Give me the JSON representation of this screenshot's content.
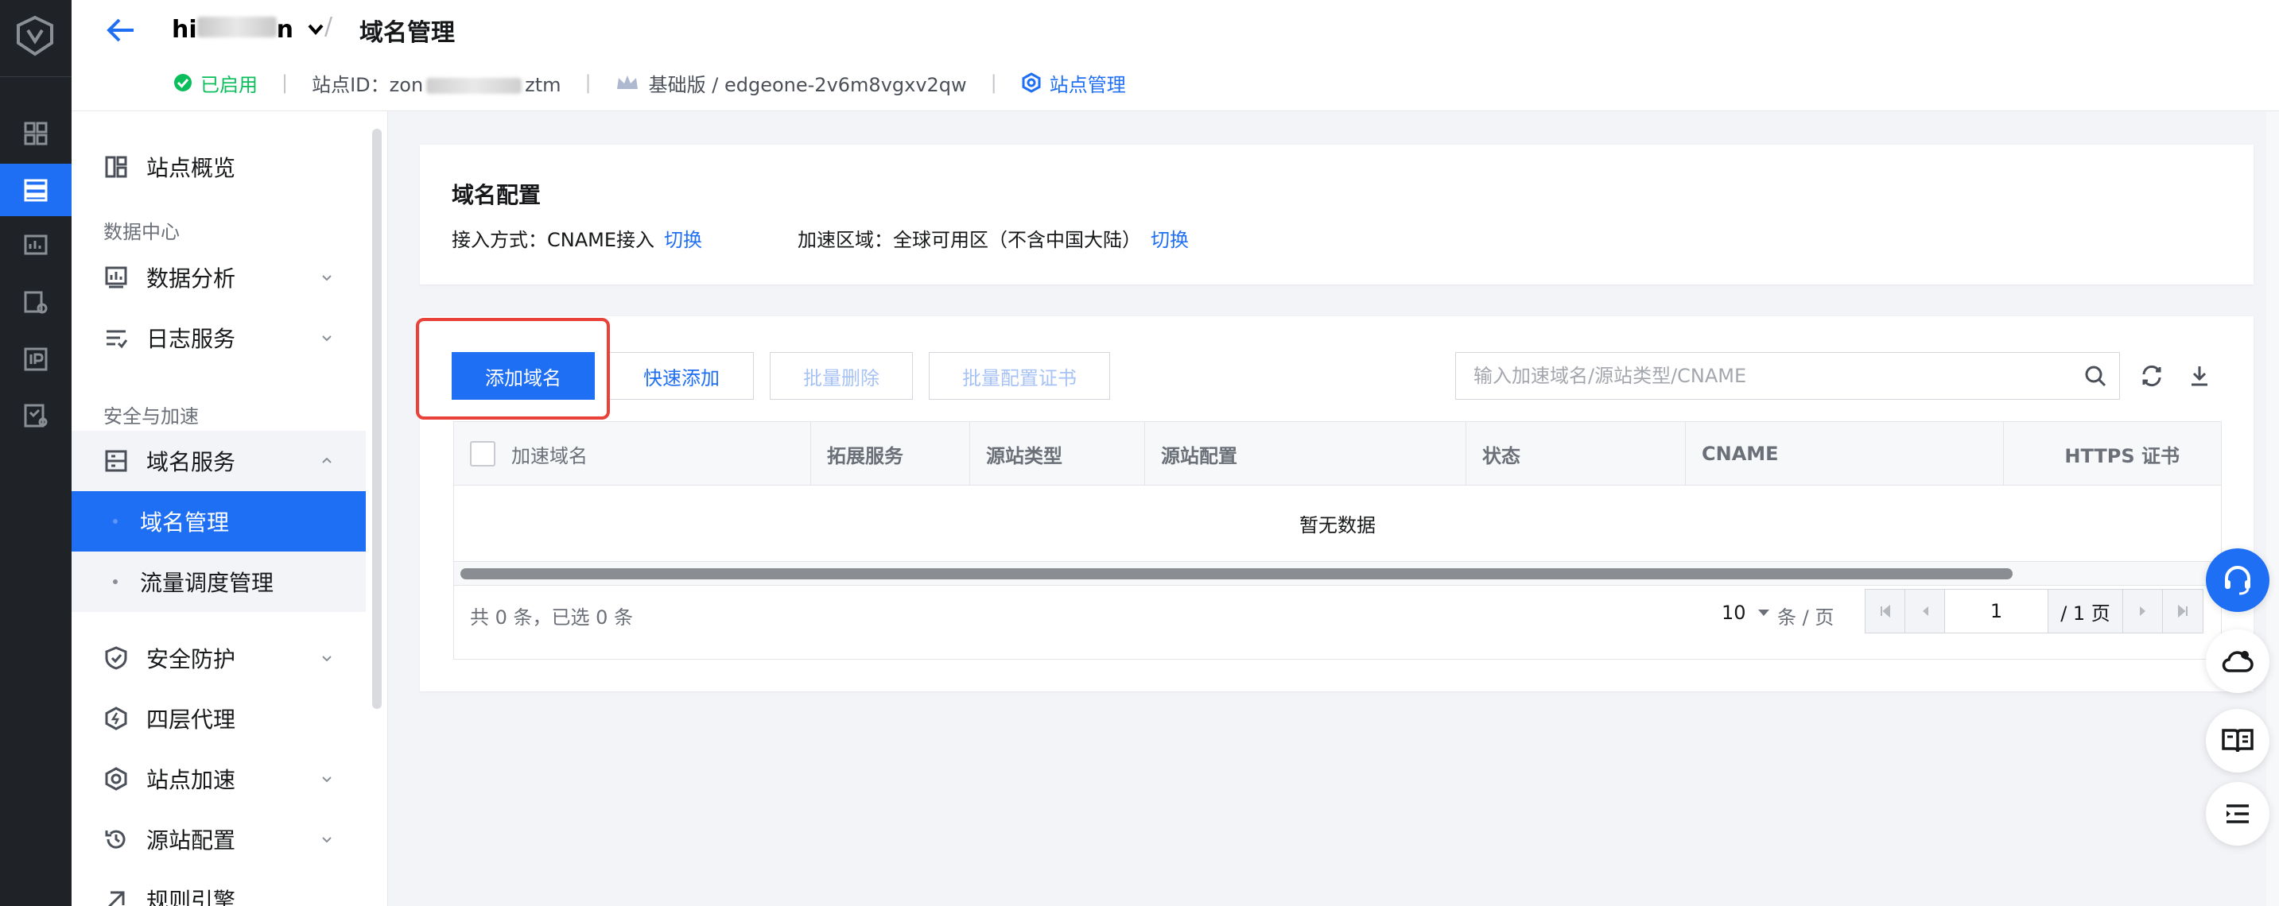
{
  "header": {
    "site_name": "hi",
    "site_name_tail": "n",
    "crumb_sep": "/",
    "page_title": "域名管理",
    "status": "已启用",
    "site_id_label": "站点ID：",
    "site_id_prefix": "zon",
    "site_id_suffix": "ztm",
    "plan": "基础版 / edgeone-2v6m8vgxv2qw",
    "site_mgmt": "站点管理",
    "meta_sep": "|"
  },
  "sidebar": {
    "overview": "站点概览",
    "group_data": "数据中心",
    "data_analysis": "数据分析",
    "log_service": "日志服务",
    "group_security": "安全与加速",
    "domain_service": "域名服务",
    "domain_mgmt": "域名管理",
    "traffic_mgmt": "流量调度管理",
    "security": "安全防护",
    "l4_proxy": "四层代理",
    "site_accel": "站点加速",
    "origin_cfg": "源站配置",
    "rules_engine": "规则引擎"
  },
  "config": {
    "title": "域名配置",
    "access_label": "接入方式：CNAME接入",
    "switch1": "切换",
    "region_label": "加速区域：全球可用区（不含中国大陆）",
    "switch2": "切换"
  },
  "toolbar": {
    "add_domain": "添加域名",
    "quick_add": "快速添加",
    "batch_delete": "批量删除",
    "batch_cert": "批量配置证书",
    "search_placeholder": "输入加速域名/源站类型/CNAME"
  },
  "table": {
    "columns": [
      "加速域名",
      "拓展服务",
      "源站类型",
      "源站配置",
      "状态",
      "CNAME",
      "HTTPS 证书"
    ],
    "empty": "暂无数据"
  },
  "pagination": {
    "total": "共 0 条，已选 0 条",
    "page_size": "10",
    "page_size_unit": "条 / 页",
    "current_page": "1",
    "total_pages": "/ 1 页"
  },
  "colors": {
    "primary": "#1f6ff5",
    "success": "#0abf5b",
    "highlight": "#e8423a",
    "rail": "#1f2328"
  }
}
